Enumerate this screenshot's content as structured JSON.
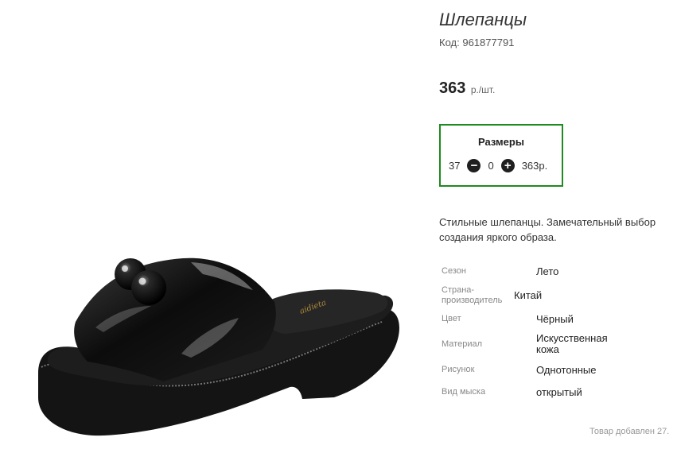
{
  "product": {
    "title": "Шлепанцы",
    "code_label": "Код:",
    "code_value": "961877791",
    "price_value": "363",
    "price_unit": "р./шт.",
    "image_icon": "sandal-photo"
  },
  "sizes": {
    "title": "Размеры",
    "rows": [
      {
        "size": "37",
        "quantity": "0",
        "total": "363р."
      }
    ]
  },
  "description": {
    "line1": "Стильные шлепанцы. Замечательный выбор",
    "line2": "создания яркого образа."
  },
  "specs": [
    {
      "label": "Сезон",
      "value": "Лето"
    },
    {
      "label": "Страна-производитель",
      "value": "Китай"
    },
    {
      "label": "Цвет",
      "value": "Чёрный"
    },
    {
      "label": "Материал",
      "value": "Искусственная кожа"
    },
    {
      "label": "Рисунок",
      "value": "Однотонные"
    },
    {
      "label": "Вид мыска",
      "value": "открытый"
    }
  ],
  "footer": {
    "added_note": "Товар добавлен 27."
  },
  "colors": {
    "sizes_border": "#1f8a1f",
    "button_bg": "#1f1f1f"
  }
}
